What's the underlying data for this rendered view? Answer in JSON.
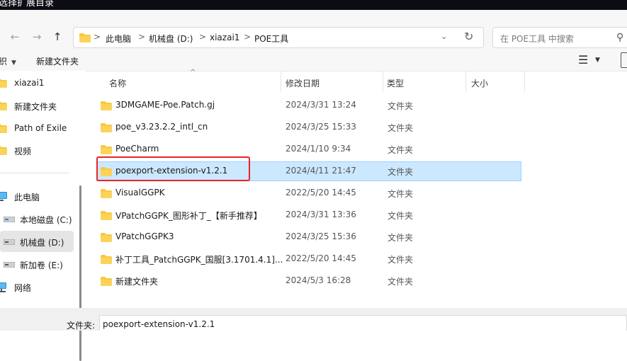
{
  "window": {
    "title_partial": "选择扩展目录"
  },
  "nav": {
    "back": "←",
    "forward": "→",
    "up": "↑",
    "breadcrumbs": [
      "此电脑",
      "机械盘 (D:)",
      "xiazai1",
      "POE工具"
    ],
    "separator": ">",
    "search_placeholder": "在 POE工具 中搜索"
  },
  "toolbar": {
    "organize_partial": "织",
    "new_folder": "新建文件夹"
  },
  "sidebar": {
    "items": [
      {
        "label": "xiazai1",
        "icon": "folder-icon"
      },
      {
        "label": "新建文件夹",
        "icon": "folder-icon"
      },
      {
        "label": "Path of Exile",
        "icon": "folder-icon"
      },
      {
        "label": "视频",
        "icon": "folder-icon"
      },
      {
        "label": "此电脑",
        "icon": "computer-icon"
      },
      {
        "label": "本地磁盘 (C:)",
        "icon": "drive-icon"
      },
      {
        "label": "机械盘 (D:)",
        "icon": "drive-icon"
      },
      {
        "label": "新加卷 (E:)",
        "icon": "drive-icon"
      },
      {
        "label": "网络",
        "icon": "network-icon"
      }
    ]
  },
  "columns": {
    "name": "名称",
    "modified": "修改日期",
    "type": "类型",
    "size": "大小"
  },
  "files": [
    {
      "name": "3DMGAME-Poe.Patch.gj",
      "date": "2024/3/31 13:24",
      "type": "文件夹"
    },
    {
      "name": "poe_v3.23.2.2_intl_cn",
      "date": "2024/3/25 15:33",
      "type": "文件夹"
    },
    {
      "name": "PoeCharm",
      "date": "2024/1/10 9:34",
      "type": "文件夹"
    },
    {
      "name": "poexport-extension-v1.2.1",
      "date": "2024/4/11 21:47",
      "type": "文件夹"
    },
    {
      "name": "VisualGGPK",
      "date": "2022/5/20 14:45",
      "type": "文件夹"
    },
    {
      "name": "VPatchGGPK_图形补丁_【新手推荐】",
      "date": "2024/3/31 13:36",
      "type": "文件夹"
    },
    {
      "name": "VPatchGGPK3",
      "date": "2024/3/25 15:36",
      "type": "文件夹"
    },
    {
      "name": "补丁工具_PatchGGPK_国服[3.1701.4.1]...",
      "date": "2022/5/20 14:45",
      "type": "文件夹"
    },
    {
      "name": "新建文件夹",
      "date": "2024/5/3 16:28",
      "type": "文件夹"
    }
  ],
  "footer": {
    "folder_label": "文件夹:",
    "folder_value": "poexport-extension-v1.2.1"
  },
  "colors": {
    "folder": "#f8c840",
    "selection": "#cce8ff",
    "highlight_border": "#e8232a"
  }
}
